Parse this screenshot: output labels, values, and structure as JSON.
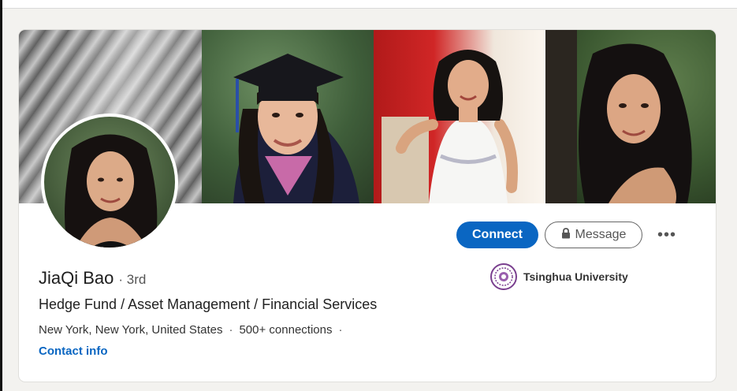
{
  "profile": {
    "name": "JiaQi Bao",
    "degree": "· 3rd",
    "headline": "Hedge Fund / Asset Management / Financial Services",
    "location": "New York, New York, United States",
    "connections": "500+ connections",
    "separator": "·",
    "contact_label": "Contact info"
  },
  "actions": {
    "connect_label": "Connect",
    "message_label": "Message",
    "more_label": "•••"
  },
  "education": {
    "school": "Tsinghua University",
    "logo_icon": "tsinghua-seal-logo"
  },
  "icons": {
    "message": "lock-icon",
    "more": "ellipsis-icon"
  },
  "colors": {
    "accent": "#0a66c2",
    "background": "#f3f2ef",
    "card": "#ffffff"
  }
}
